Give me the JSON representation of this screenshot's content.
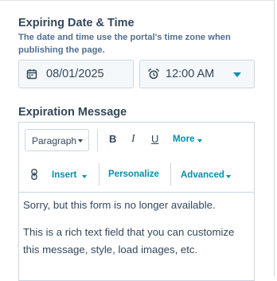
{
  "expiring": {
    "title": "Expiring Date & Time",
    "help": "The date and time use the portal's time zone when publishing the page.",
    "date_value": "08/01/2025",
    "time_value": "12:00 AM"
  },
  "message": {
    "title": "Expiration Message",
    "toolbar": {
      "paragraph_label": "Paragraph",
      "bold_label": "B",
      "italic_label": "I",
      "underline_label": "U",
      "more_label": "More",
      "insert_label": "Insert",
      "personalize_label": "Personalize",
      "advanced_label": "Advanced"
    },
    "content": [
      "Sorry, but this form is no longer available.",
      "This is a rich text field that you can customize this message, style, load images, etc."
    ]
  },
  "colors": {
    "accent": "#0091ae",
    "text": "#33475b",
    "border": "#cbd6e2",
    "field_bg": "#f5f8fa"
  },
  "icons": [
    "calendar-icon",
    "alarm-clock-icon",
    "link-icon",
    "chevron-down-icon"
  ]
}
